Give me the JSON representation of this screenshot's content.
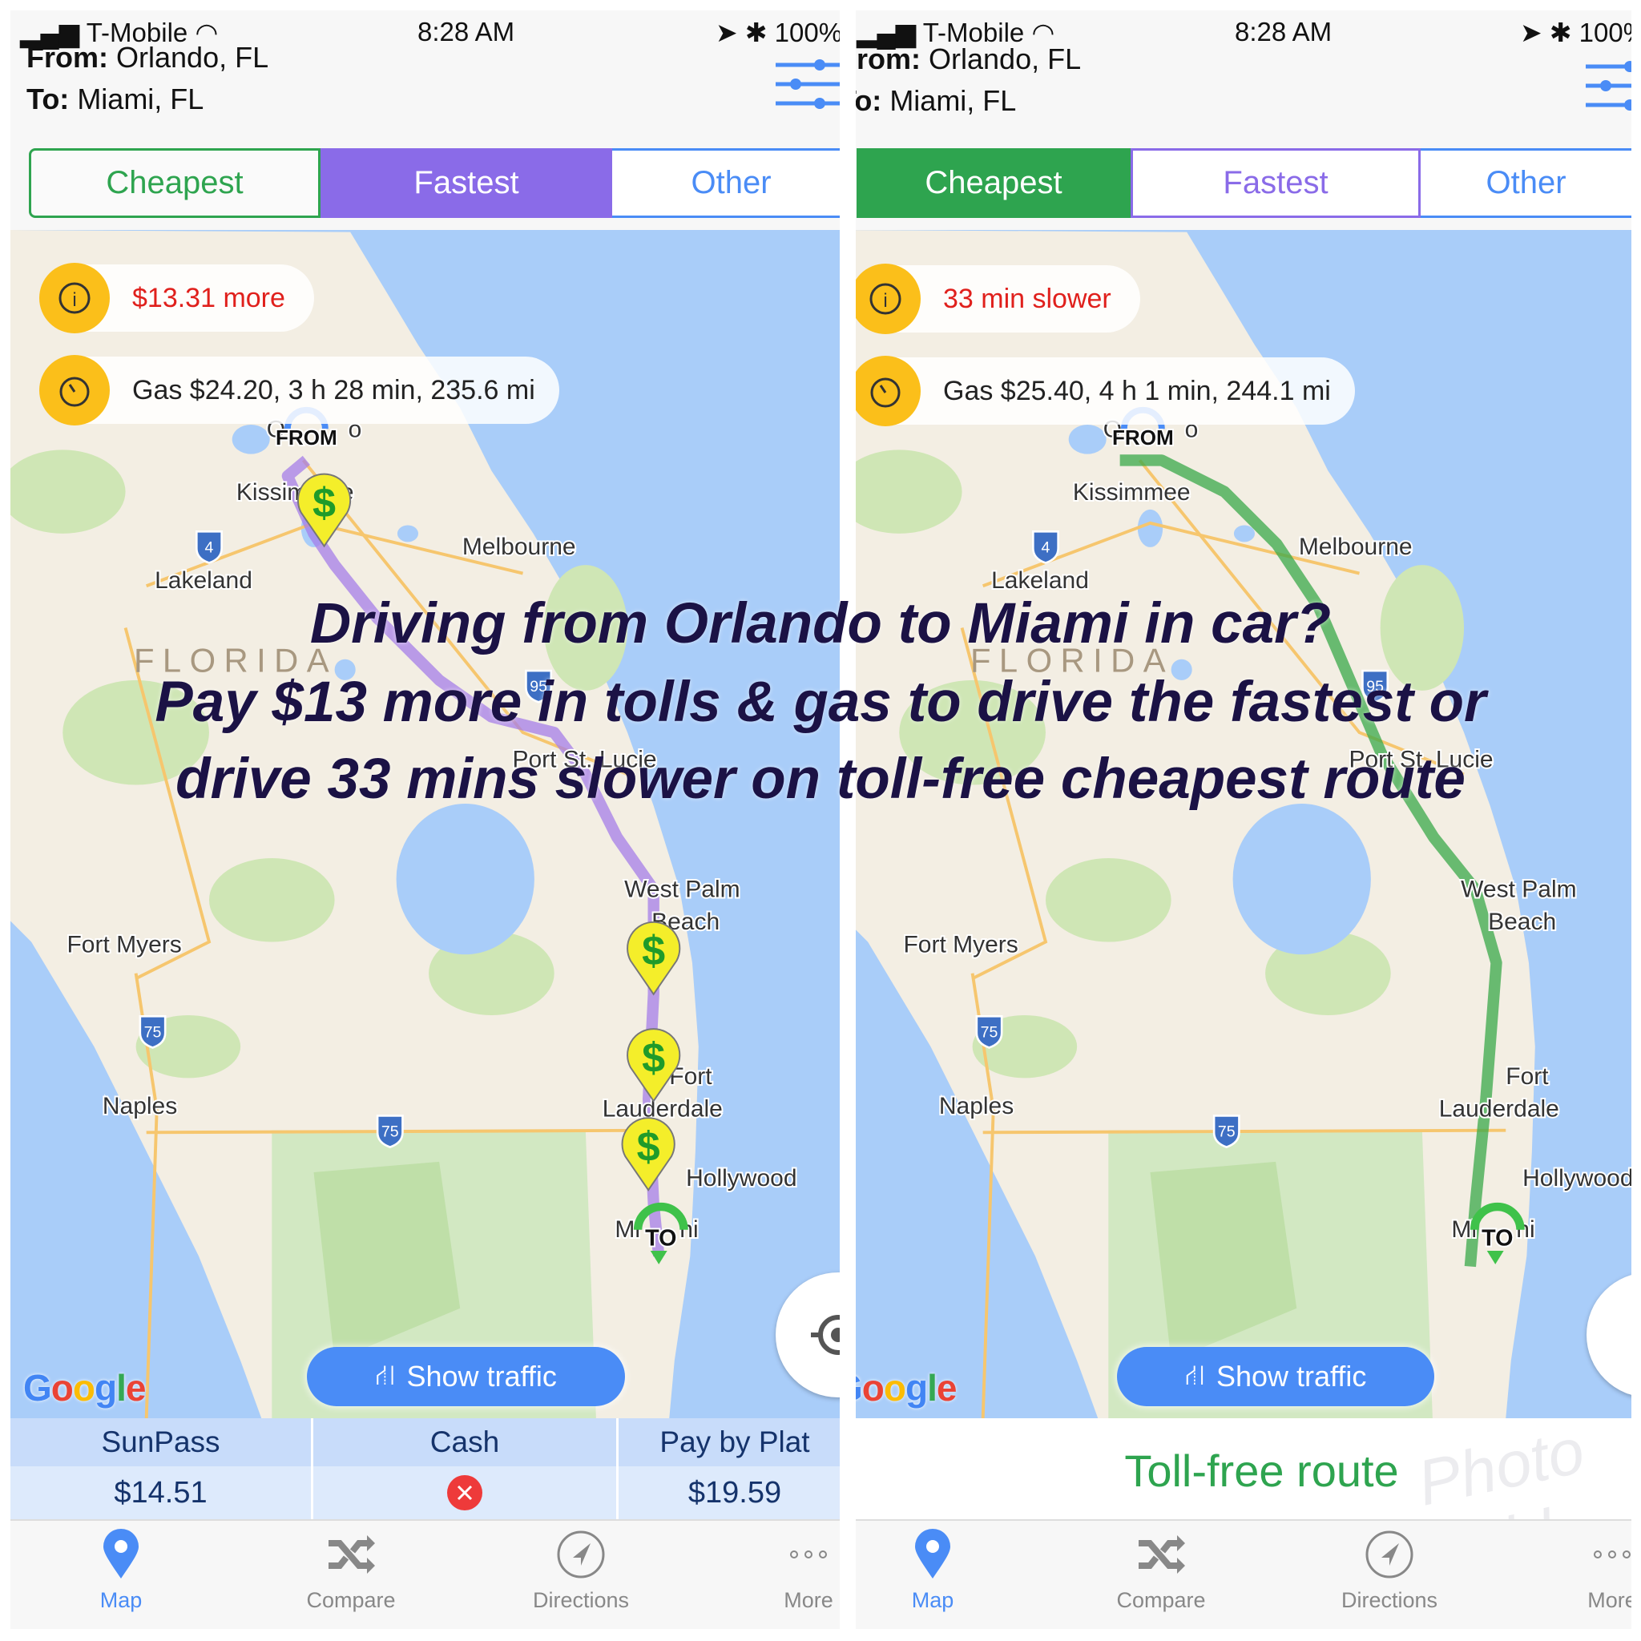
{
  "status_bar": {
    "carrier": "T-Mobile",
    "time": "8:28 AM",
    "battery": "100%"
  },
  "route": {
    "from_label": "From:",
    "from": "Orlando, FL",
    "to_label": "To:",
    "to": "Miami, FL"
  },
  "tabs": [
    {
      "label": "Cheapest"
    },
    {
      "label": "Fastest"
    },
    {
      "label": "Other"
    }
  ],
  "colors": {
    "cheapest": "#2ea44f",
    "fastest": "#8a6be8",
    "other": "#4a8cf6",
    "pill_icon": "#fbbf1a"
  },
  "left": {
    "selected_tab": "Fastest",
    "diff": "$13.31 more",
    "summary": "Gas $24.20, 3 h 28 min, 235.6 mi",
    "tolls": [
      {
        "name": "SunPass",
        "value": "$14.51"
      },
      {
        "name": "Cash",
        "value": "",
        "icon": "x-circle-icon"
      },
      {
        "name": "Pay by Plat",
        "value": "$19.59"
      }
    ]
  },
  "right": {
    "selected_tab": "Cheapest",
    "diff": "33 min slower",
    "summary": "Gas $25.40, 4 h 1 min, 244.1 mi",
    "toll_free": "Toll-free route"
  },
  "map": {
    "show_traffic": "Show traffic",
    "google": "Google",
    "from_marker": "FROM",
    "to_marker": "TO",
    "cities": [
      "O",
      "o",
      "Kissimmee",
      "Lakeland",
      "Melbourne",
      "FLORIDA",
      "Port St. Lucie",
      "West Palm",
      "Beach",
      "Fort Myers",
      "Naples",
      "Fort",
      "Lauderdale",
      "Hollywood",
      "Mi",
      "ni"
    ],
    "shields": [
      "4",
      "95",
      "75",
      "75"
    ]
  },
  "tabbar": [
    {
      "label": "Map",
      "icon": "map-pin-icon"
    },
    {
      "label": "Compare",
      "icon": "shuffle-icon"
    },
    {
      "label": "Directions",
      "icon": "compass-icon"
    },
    {
      "label": "More",
      "icon": "more-icon"
    }
  ],
  "overlay": {
    "line1": "Driving from Orlando to Miami in car?",
    "line2": "Pay $13 more in tolls & gas to drive the fastest or",
    "line3": "drive 33 mins slower on toll-free cheapest route"
  },
  "watermark": "Photo Grid"
}
